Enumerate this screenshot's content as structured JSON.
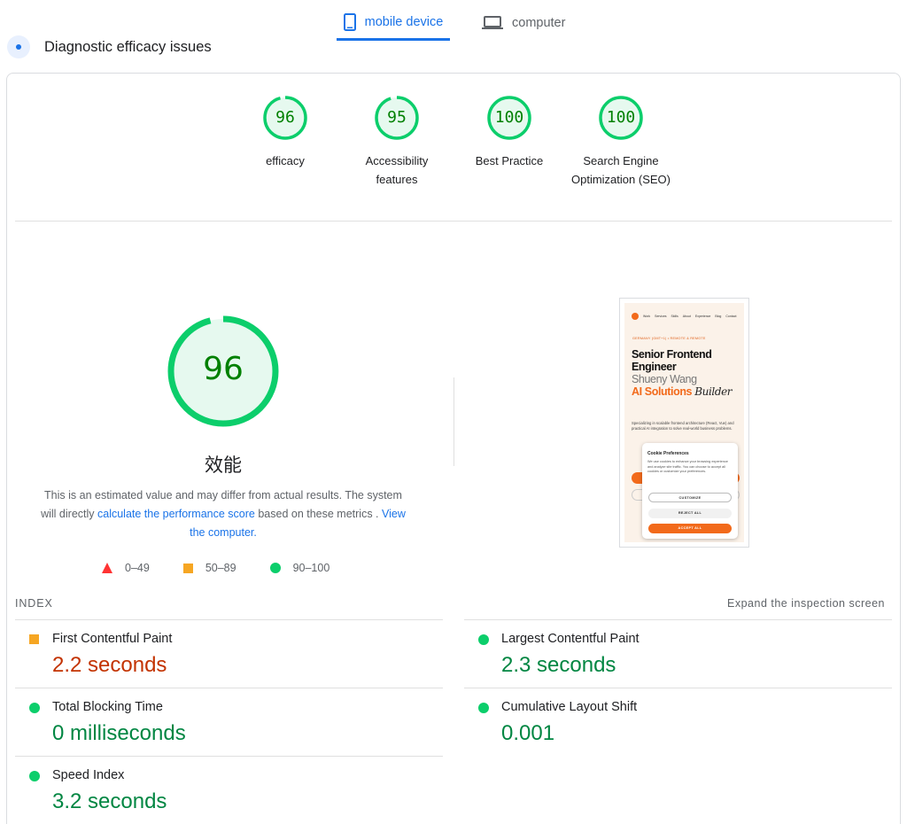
{
  "tabs": [
    {
      "label": "mobile device",
      "icon": "smartphone-icon",
      "active": true
    },
    {
      "label": "computer",
      "icon": "laptop-icon",
      "active": false
    }
  ],
  "header": {
    "title": "Diagnostic efficacy issues"
  },
  "gauges": [
    {
      "score": 96,
      "label": "efficacy"
    },
    {
      "score": 95,
      "label": "Accessibility features"
    },
    {
      "score": 100,
      "label": "Best Practice"
    },
    {
      "score": 100,
      "label": "Search Engine Optimization (SEO)"
    }
  ],
  "main_gauge": {
    "score": "96",
    "title": "效能",
    "note_prefix": "This is an estimated value and may differ from actual results. The system will directly ",
    "note_link1": "calculate the performance score",
    "note_middle": " based on these metrics . ",
    "note_link2": "View the computer."
  },
  "legend": [
    {
      "shape": "triangle",
      "range": "0–49",
      "color": "#ff3333"
    },
    {
      "shape": "square",
      "range": "50–89",
      "color": "#f6a623"
    },
    {
      "shape": "circle",
      "range": "90–100",
      "color": "#0cce6b"
    }
  ],
  "screenshot": {
    "nav": [
      "Work",
      "Services",
      "Skills",
      "About",
      "Experience",
      "Blog",
      "Contact"
    ],
    "badge": "GERMANY (GMT+1) • REMOTE & REMOTE",
    "headline1": "Senior Frontend Engineer",
    "headline2": "Shueny Wang",
    "headline3a": "AI Solutions",
    "headline3b": "Builder",
    "paragraph": "Specializing in scalable frontend architecture (React, Vue) and practical AI integration to solve real-world business problems.",
    "cookie": {
      "title": "Cookie Preferences",
      "text": "We use cookies to enhance your browsing experience and analyze site traffic. You can choose to accept all cookies or customize your preferences.",
      "customize": "CUSTOMIZE",
      "reject": "REJECT ALL",
      "accept": "ACCEPT ALL"
    }
  },
  "metrics": {
    "heading": "INDEX",
    "expand": "Expand the inspection screen",
    "items": [
      {
        "name": "First Contentful Paint",
        "value": "2.2 seconds",
        "status": "average"
      },
      {
        "name": "Largest Contentful Paint",
        "value": "2.3 seconds",
        "status": "good"
      },
      {
        "name": "Total Blocking Time",
        "value": "0 milliseconds",
        "status": "good"
      },
      {
        "name": "Cumulative Layout Shift",
        "value": "0.001",
        "status": "good"
      },
      {
        "name": "Speed Index",
        "value": "3.2 seconds",
        "status": "good"
      }
    ]
  },
  "colors": {
    "accent": "#1a73e8",
    "good": "#0cce6b",
    "average": "#f6a623",
    "poor": "#ff3333"
  }
}
